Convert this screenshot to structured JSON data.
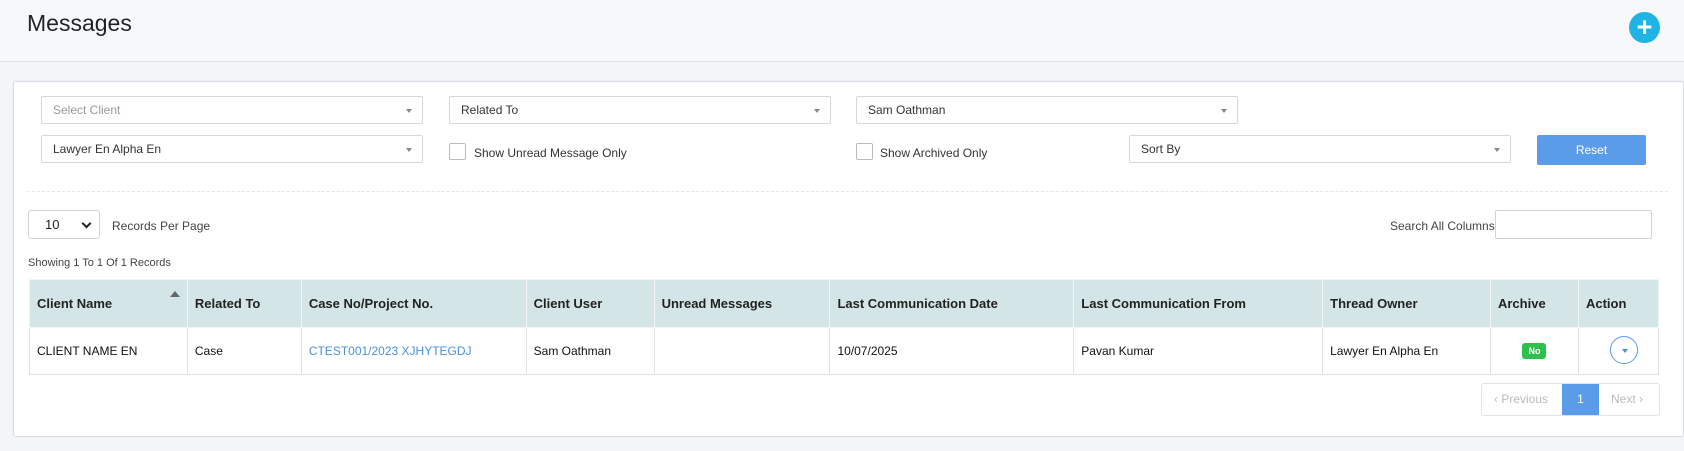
{
  "header": {
    "title": "Messages",
    "add_icon": "plus-icon",
    "add_label": "+"
  },
  "filters": {
    "client": {
      "placeholder": "Select Client"
    },
    "related_to": {
      "value": "Related To"
    },
    "user": {
      "value": "Sam Oathman"
    },
    "lawyer": {
      "value": "Lawyer En Alpha En"
    },
    "unread_only": {
      "label": "Show Unread Message Only",
      "checked": false
    },
    "archived_only": {
      "label": "Show Archived Only",
      "checked": false
    },
    "sort_by": {
      "value": "Sort By"
    },
    "reset_label": "Reset"
  },
  "list": {
    "records_per_page": "10",
    "records_per_page_label": "Records Per Page",
    "search_label": "Search All Columns",
    "search_value": "",
    "showing": "Showing 1 To 1 Of 1 Records"
  },
  "table": {
    "columns": [
      "Client Name",
      "Related To",
      "Case No/Project No.",
      "Client User",
      "Unread Messages",
      "Last Communication Date",
      "Last Communication From",
      "Thread Owner",
      "Archive",
      "Action"
    ],
    "rows": [
      {
        "client_name": "CLIENT NAME EN",
        "related_to": "Case",
        "case_no": "CTEST001/2023 XJHYTEGDJ",
        "client_user": "Sam Oathman",
        "unread_messages": "",
        "last_comm_date": "10/07/2025",
        "last_comm_from": "Pavan Kumar",
        "thread_owner": "Lawyer En Alpha En",
        "archive": "No"
      }
    ]
  },
  "pagination": {
    "previous": "‹  Previous",
    "current": "1",
    "next": "Next  ›"
  },
  "colors": {
    "accent": "#1fb4e3",
    "primary_button": "#5b9ce8",
    "table_header": "#d4e5e8",
    "badge_green": "#2fbf4f",
    "link": "#4a90d9"
  }
}
